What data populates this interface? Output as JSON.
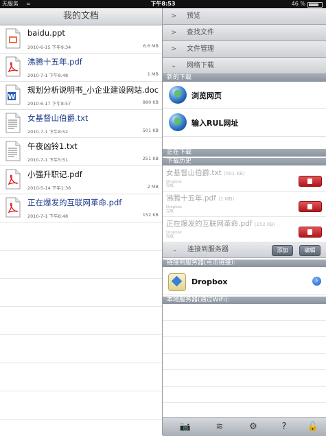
{
  "status": {
    "carrier": "无服务",
    "wifi": "≈",
    "time": "下午8:53",
    "battery": "46 %"
  },
  "left": {
    "title": "我的文档",
    "docs": [
      {
        "name": "baidu.ppt",
        "date": "2010-6-15 下午9:34",
        "size": "6.6 MB",
        "type": "ppt",
        "icon": "ppt-file-icon",
        "blue": false
      },
      {
        "name": "沸腾十五年.pdf",
        "date": "2010-7-1 下午8:48",
        "size": "1 MB",
        "type": "pdf",
        "icon": "pdf-file-icon",
        "blue": true
      },
      {
        "name": "规划分析说明书_小企业建设网站.doc",
        "date": "2010-6-17 下午8:57",
        "size": "880 KB",
        "type": "doc",
        "icon": "doc-file-icon",
        "blue": false
      },
      {
        "name": "女基督山伯爵.txt",
        "date": "2010-7-1 下午8:52",
        "size": "501 KB",
        "type": "txt",
        "icon": "txt-file-icon",
        "blue": true
      },
      {
        "name": "午夜凶铃1.txt",
        "date": "2010-7-1 下午5:51",
        "size": "251 KB",
        "type": "txt",
        "icon": "txt-file-icon",
        "blue": false
      },
      {
        "name": "小强升职记.pdf",
        "date": "2010-5-14 下午1:38",
        "size": "2 MB",
        "type": "pdf",
        "icon": "pdf-file-icon",
        "blue": false
      },
      {
        "name": "正在爆发的互联网革命.pdf",
        "date": "2010-7-1 下午8:48",
        "size": "152 KB",
        "type": "pdf",
        "icon": "pdf-file-icon",
        "blue": true
      }
    ]
  },
  "right": {
    "menu": [
      "预览",
      "查找文件",
      "文件管理",
      "网络下载"
    ],
    "new_download_header": "新的下载",
    "browse_label": "浏览网页",
    "enter_url_label": "输入RUL网址",
    "downloading_header": "正在下载",
    "history_header": "下载历史",
    "history": [
      {
        "title": "女基督山伯爵.txt",
        "size": "(501 KB)",
        "source": "Dropbox",
        "status": "完成"
      },
      {
        "title": "沸腾十五年.pdf",
        "size": "(1 MB)",
        "source": "Dropbox",
        "status": "完成"
      },
      {
        "title": "正在爆发的互联网革命.pdf",
        "size": "(152 KB)",
        "source": "Dropbox",
        "status": "完成"
      }
    ],
    "connect_label": "连接到服务器",
    "add_label": "添加",
    "edit_label": "编辑",
    "linked_header": "链接到服务器(点击链接):",
    "dropbox_label": "Dropbox",
    "local_header": "本地服务器(通过WiFi):",
    "toolbar_icons": [
      "camera-icon",
      "wifi-icon",
      "gear-icon",
      "help-icon",
      "lock-icon"
    ],
    "toolbar_glyphs": [
      "📷",
      "≋",
      "⚙",
      "?",
      "🔓"
    ]
  },
  "colors": {
    "delete_red": "#c8282d",
    "link_blue": "#1d3a8a",
    "section_gray": "#96a0ab"
  }
}
